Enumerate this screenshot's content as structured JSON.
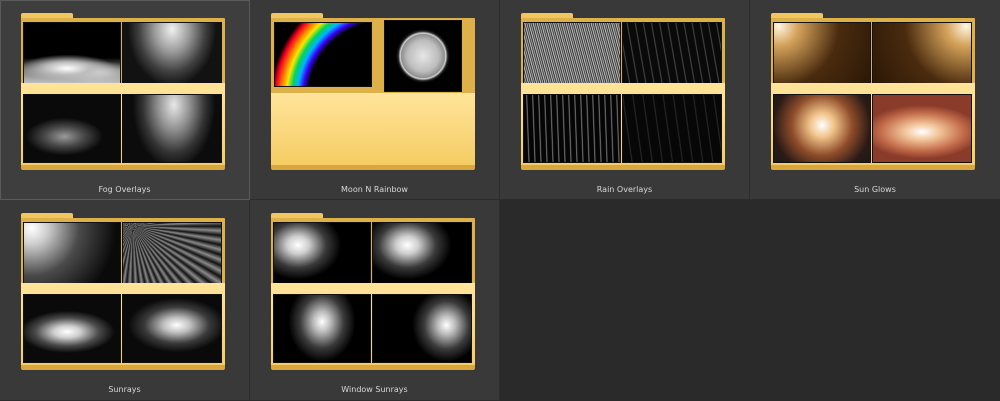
{
  "folders": [
    {
      "label": "Fog Overlays",
      "selected": true,
      "thumbnails": [
        "fog-clouds",
        "fog-light-beam",
        "fog-smoke",
        "fog-light-beam-2"
      ]
    },
    {
      "label": "Moon N Rainbow",
      "selected": false,
      "thumbnails": [
        "rainbow",
        "full-moon"
      ]
    },
    {
      "label": "Rain Overlays",
      "selected": false,
      "thumbnails": [
        "rain-dense",
        "rain-sparse",
        "rain-streaks",
        "rain-dark"
      ]
    },
    {
      "label": "Sun Glows",
      "selected": false,
      "thumbnails": [
        "sun-glow-left",
        "sun-glow-right",
        "sun-burst",
        "sun-horizon"
      ]
    },
    {
      "label": "Sunrays",
      "selected": false,
      "thumbnails": [
        "sunray-corner",
        "sunray-streaks",
        "sunray-burst",
        "sunray-center"
      ]
    },
    {
      "label": "Window Sunrays",
      "selected": false,
      "thumbnails": [
        "window-ray-1",
        "window-ray-2",
        "window-ray-3",
        "window-ray-4"
      ]
    }
  ],
  "colors": {
    "background": "#2a2a2a",
    "tile": "#393939",
    "folder": "#f5cc62",
    "label_text": "#d8d8d8"
  }
}
